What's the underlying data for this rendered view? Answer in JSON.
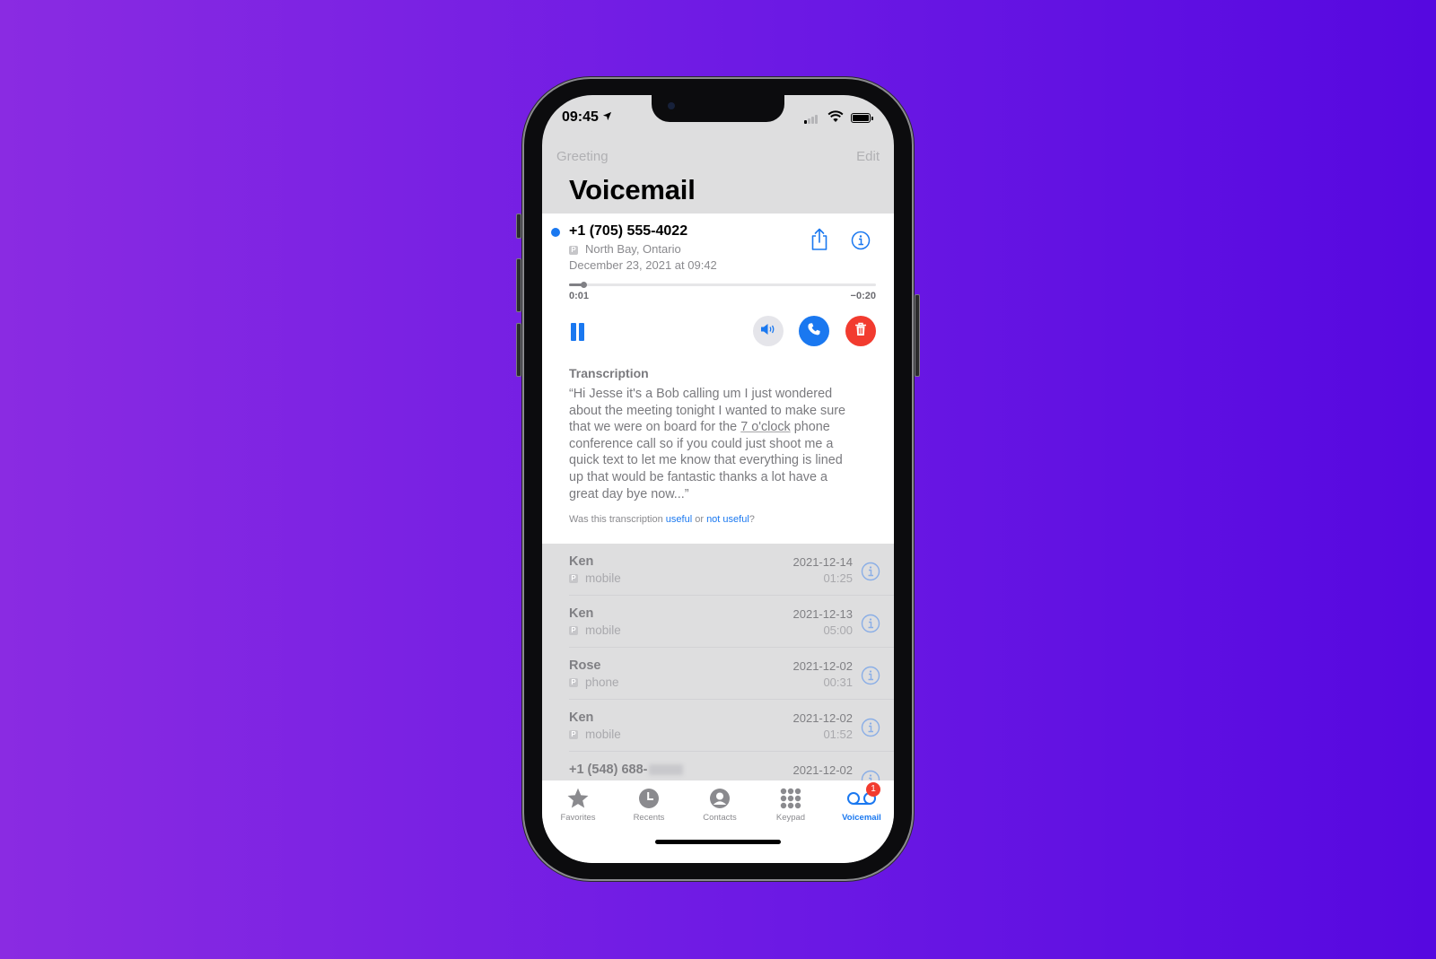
{
  "status_bar": {
    "time": "09:45",
    "location_icon": "location-arrow-icon",
    "signal_icon": "cellular-signal-icon",
    "wifi_icon": "wifi-icon",
    "battery_icon": "battery-icon"
  },
  "nav": {
    "left_label": "Greeting",
    "right_label": "Edit",
    "title": "Voicemail"
  },
  "active_voicemail": {
    "caller": "+1 (705) 555-4022",
    "badge": "P",
    "location": "North Bay, Ontario",
    "datetime": "December 23, 2021 at 09:42",
    "elapsed": "0:01",
    "remaining": "−0:20",
    "progress_fraction": 0.048,
    "transcription_label": "Transcription",
    "transcription_before": "“Hi Jesse it's a Bob calling um I just wondered\n about the meeting tonight I wanted to make sure\n that we were on board for the ",
    "transcription_link": "7 o'clock",
    "transcription_after": " phone\n conference call so if you could just shoot me a\n quick text to let me know that everything is lined\n up that would be fantastic thanks a lot have a\n great day bye now...”",
    "feedback_prefix": "Was this transcription ",
    "feedback_useful": "useful",
    "feedback_or": " or ",
    "feedback_not_useful": "not useful",
    "feedback_suffix": "?",
    "colors": {
      "accent": "#1a78f0",
      "delete": "#f23b2f"
    }
  },
  "voicemails": [
    {
      "name": "Ken",
      "badge": "P",
      "label": "mobile",
      "date": "2021-12-14",
      "duration": "01:25"
    },
    {
      "name": "Ken",
      "badge": "P",
      "label": "mobile",
      "date": "2021-12-13",
      "duration": "05:00"
    },
    {
      "name": "Rose",
      "badge": "P",
      "label": "phone",
      "date": "2021-12-02",
      "duration": "00:31"
    },
    {
      "name": "Ken",
      "badge": "P",
      "label": "mobile",
      "date": "2021-12-02",
      "duration": "01:52"
    },
    {
      "name": "+1 (548) 688-",
      "badge": "",
      "label": "",
      "date": "2021-12-02",
      "duration": ""
    }
  ],
  "tabs": [
    {
      "label": "Favorites",
      "icon": "star-icon"
    },
    {
      "label": "Recents",
      "icon": "clock-icon"
    },
    {
      "label": "Contacts",
      "icon": "person-circle-icon"
    },
    {
      "label": "Keypad",
      "icon": "keypad-icon"
    },
    {
      "label": "Voicemail",
      "icon": "voicemail-icon",
      "active": true,
      "badge": "1"
    }
  ]
}
